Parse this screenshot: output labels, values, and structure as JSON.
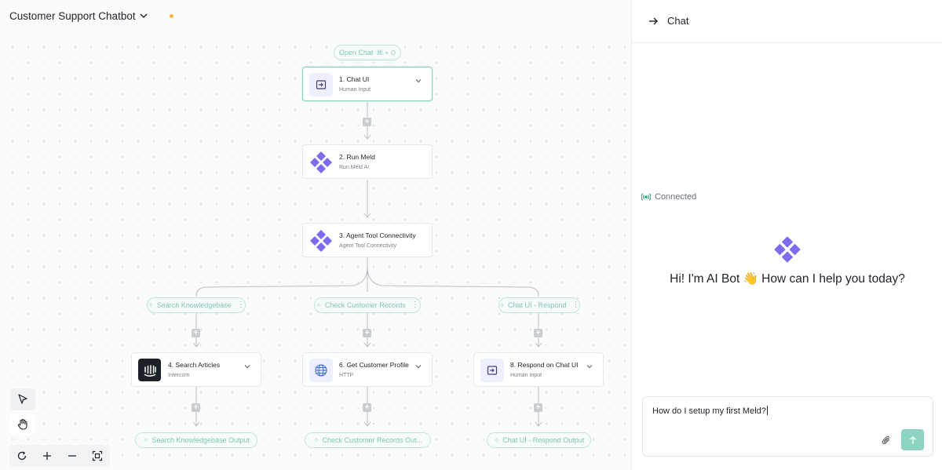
{
  "workflow": {
    "title": "Customer Support Chatbot"
  },
  "trigger": {
    "label": "Open Chat",
    "shortcut": "⌘ + O"
  },
  "nodes": [
    {
      "title": "1. Chat UI",
      "subtitle": "Human Input",
      "icon": "input-icon"
    },
    {
      "title": "2. Run Meld",
      "subtitle": "Run Meld AI",
      "icon": "meld-logo-icon"
    },
    {
      "title": "3. Agent Tool Connectivity",
      "subtitle": "Agent Tool Connectivity",
      "icon": "meld-logo-icon"
    },
    {
      "title": "4. Search Articles",
      "subtitle": "Intercom",
      "icon": "intercom-icon"
    },
    {
      "title": "6. Get Customer Profile",
      "subtitle": "HTTP",
      "icon": "globe-icon"
    },
    {
      "title": "8. Respond on Chat UI",
      "subtitle": "Human Input",
      "icon": "input-icon"
    }
  ],
  "branches": [
    {
      "label": "Search Knowledgebase"
    },
    {
      "label": "Check Customer Records"
    },
    {
      "label": "Chat UI - Respond"
    }
  ],
  "outputs": [
    {
      "label": "Search Knowledgebase Output"
    },
    {
      "label": "Check Customer Records Out..."
    },
    {
      "label": "Chat UI - Respond Output"
    }
  ],
  "chat": {
    "title": "Chat",
    "status": "Connected",
    "greeting": "Hi! I'm AI Bot 👋 How can I help you today?",
    "input_value": "How do I setup my first Meld?"
  },
  "colors": {
    "accent": "#86d1c1",
    "meld": "#7b6cf0",
    "send": "#8dd3c2",
    "unsaved": "#f4b63f"
  }
}
